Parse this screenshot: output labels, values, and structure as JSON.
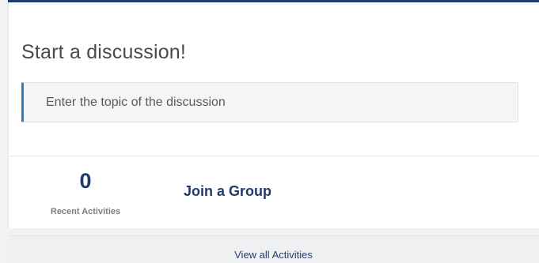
{
  "discussion": {
    "title": "Start a discussion!",
    "topic_placeholder": "Enter the topic of the discussion"
  },
  "activity": {
    "count": "0",
    "count_label": "Recent Activities",
    "join_group_label": "Join a Group"
  },
  "footer": {
    "view_all_label": "View all Activities"
  },
  "colors": {
    "brand_navy": "#1f3a6e",
    "input_accent": "#2f7fc2",
    "page_background": "#f1f2f4"
  }
}
